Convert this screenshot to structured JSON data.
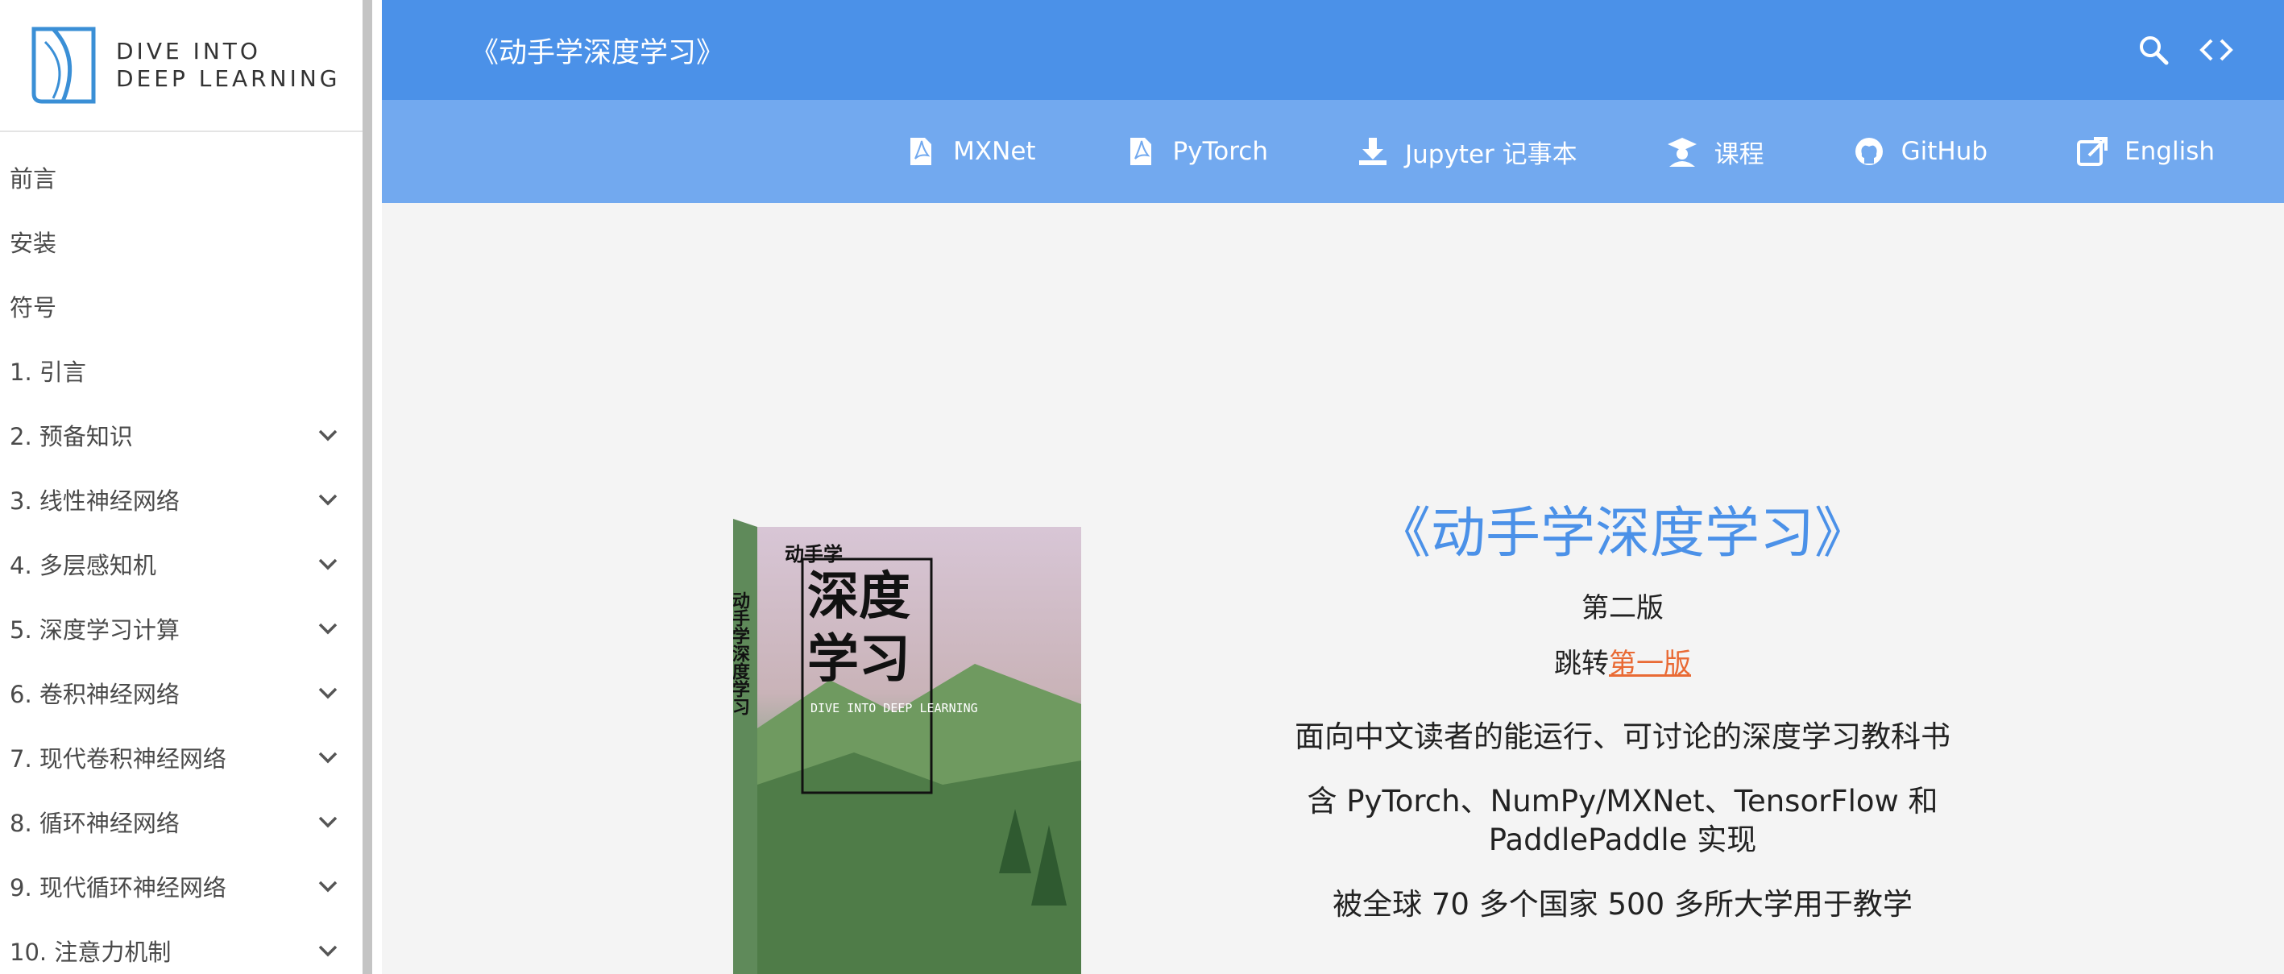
{
  "logo": {
    "line1": "DIVE INTO",
    "line2": "DEEP LEARNING"
  },
  "sidebar": {
    "items": [
      {
        "label": "前言",
        "expandable": false
      },
      {
        "label": "安装",
        "expandable": false
      },
      {
        "label": "符号",
        "expandable": false
      },
      {
        "label": "1. 引言",
        "expandable": false
      },
      {
        "label": "2. 预备知识",
        "expandable": true
      },
      {
        "label": "3. 线性神经网络",
        "expandable": true
      },
      {
        "label": "4. 多层感知机",
        "expandable": true
      },
      {
        "label": "5. 深度学习计算",
        "expandable": true
      },
      {
        "label": "6. 卷积神经网络",
        "expandable": true
      },
      {
        "label": "7. 现代卷积神经网络",
        "expandable": true
      },
      {
        "label": "8. 循环神经网络",
        "expandable": true
      },
      {
        "label": "9. 现代循环神经网络",
        "expandable": true
      },
      {
        "label": "10. 注意力机制",
        "expandable": true
      }
    ]
  },
  "header": {
    "title": "《动手学深度学习》",
    "icons": [
      "search-icon",
      "code-icon"
    ]
  },
  "nav": {
    "links": [
      {
        "label": "MXNet",
        "icon": "pdf-icon"
      },
      {
        "label": "PyTorch",
        "icon": "pdf-icon"
      },
      {
        "label": "Jupyter 记事本",
        "icon": "download-icon"
      },
      {
        "label": "课程",
        "icon": "teacher-icon"
      },
      {
        "label": "GitHub",
        "icon": "github-icon"
      },
      {
        "label": "English",
        "icon": "external-link-icon"
      }
    ]
  },
  "hero": {
    "title": "《动手学深度学习》",
    "edition": "第二版",
    "jump_prefix": "跳转",
    "jump_link": "第一版",
    "line1": "面向中文读者的能运行、可讨论的深度学习教科书",
    "line2": "含 PyTorch、NumPy/MXNet、TensorFlow 和 PaddlePaddle 实现",
    "line3": "被全球 70 多个国家 500 多所大学用于教学"
  },
  "cover": {
    "publisher_mark": "动手学",
    "title_line1": "深度",
    "title_line2": "学习",
    "spine": "动手学深度学习",
    "english_title": "DIVE INTO DEEP LEARNING"
  },
  "colors": {
    "topbar": "#4b91e8",
    "navbar": "#72a9ef",
    "accent_title": "#4b91e8",
    "link": "#e96a34",
    "main_bg": "#f4f4f4"
  }
}
